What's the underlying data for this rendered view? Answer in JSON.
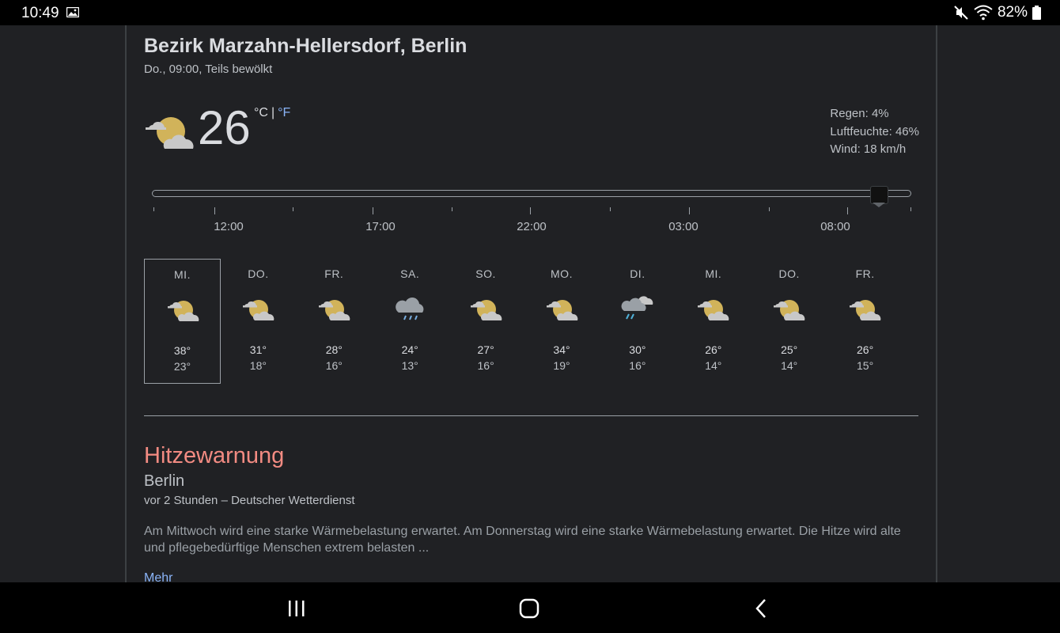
{
  "status_bar": {
    "time": "10:49",
    "battery": "82%"
  },
  "location": {
    "name": "Bezirk Marzahn-Hellersdorf, Berlin",
    "subtitle": "Do., 09:00, Teils bewölkt"
  },
  "current": {
    "temperature": "26",
    "unit_c": "°C",
    "separator": "|",
    "unit_f": "°F",
    "icon": "partly-cloudy-icon",
    "details": [
      "Regen: 4%",
      "Luftfeuchte: 46%",
      "Wind: 18 km/h"
    ]
  },
  "timeline": {
    "labels": [
      "12:00",
      "17:00",
      "22:00",
      "03:00",
      "08:00"
    ],
    "position": 0.957
  },
  "days": [
    {
      "name": "MI.",
      "hi": "38°",
      "lo": "23°",
      "icon": "partly-cloudy-icon"
    },
    {
      "name": "DO.",
      "hi": "31°",
      "lo": "18°",
      "icon": "partly-cloudy-icon"
    },
    {
      "name": "FR.",
      "hi": "28°",
      "lo": "16°",
      "icon": "partly-cloudy-icon"
    },
    {
      "name": "SA.",
      "hi": "24°",
      "lo": "13°",
      "icon": "rain-icon"
    },
    {
      "name": "SO.",
      "hi": "27°",
      "lo": "16°",
      "icon": "partly-cloudy-icon"
    },
    {
      "name": "MO.",
      "hi": "34°",
      "lo": "19°",
      "icon": "partly-cloudy-icon"
    },
    {
      "name": "DI.",
      "hi": "30°",
      "lo": "16°",
      "icon": "thunder-showers-icon"
    },
    {
      "name": "MI.",
      "hi": "26°",
      "lo": "14°",
      "icon": "partly-cloudy-icon"
    },
    {
      "name": "DO.",
      "hi": "25°",
      "lo": "14°",
      "icon": "partly-cloudy-icon"
    },
    {
      "name": "FR.",
      "hi": "26°",
      "lo": "15°",
      "icon": "partly-cloudy-icon"
    }
  ],
  "selected_day": 0,
  "warning": {
    "title": "Hitzewarnung",
    "city": "Berlin",
    "meta": "vor 2 Stunden – Deutscher Wetterdienst",
    "text": "Am Mittwoch wird eine starke Wärmebelastung erwartet. Am Donnerstag wird eine starke Wärmebelastung erwartet. Die Hitze wird alte und pflegebedürftige Menschen extrem belasten ...",
    "more": "Mehr"
  },
  "colors": {
    "warning": "#f28b82",
    "link": "#8ab4f8",
    "sun": "#d1b35a",
    "cloud": "#c8c8c8"
  }
}
